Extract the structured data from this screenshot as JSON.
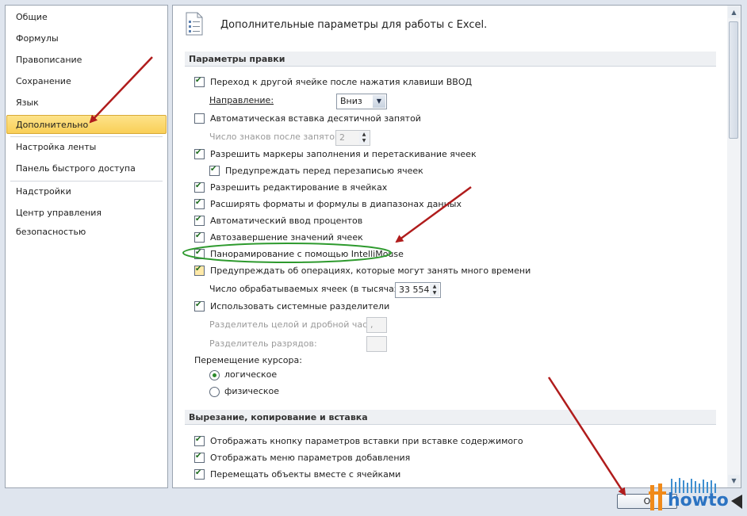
{
  "sidebar": {
    "items": [
      {
        "label": "Общие"
      },
      {
        "label": "Формулы"
      },
      {
        "label": "Правописание"
      },
      {
        "label": "Сохранение"
      },
      {
        "label": "Язык"
      },
      {
        "label": "Дополнительно",
        "selected": true
      },
      {
        "label": "Настройка ленты"
      },
      {
        "label": "Панель быстрого доступа"
      },
      {
        "label": "Надстройки"
      },
      {
        "label": "Центр управления безопасностью"
      }
    ]
  },
  "header": {
    "title": "Дополнительные параметры для работы с Excel."
  },
  "sections": {
    "editing": {
      "title": "Параметры правки",
      "move_after_enter": {
        "label": "Переход к другой ячейке после нажатия клавиши ВВОД",
        "checked": true
      },
      "direction": {
        "label": "Направление:",
        "value": "Вниз"
      },
      "auto_decimal": {
        "label": "Автоматическая вставка десятичной запятой",
        "checked": false
      },
      "decimal_places": {
        "label": "Число знаков после запятой:",
        "value": "2"
      },
      "fill_handle": {
        "label": "Разрешить маркеры заполнения и перетаскивание ячеек",
        "checked": true
      },
      "overwrite_warn": {
        "label": "Предупреждать перед перезаписью ячеек",
        "checked": true
      },
      "edit_in_cell": {
        "label": "Разрешить редактирование в ячейках",
        "checked": true
      },
      "extend_formats": {
        "label": "Расширять форматы и формулы в диапазонах данных",
        "checked": true
      },
      "auto_percent": {
        "label": "Автоматический ввод процентов",
        "checked": true
      },
      "autocomplete": {
        "label": "Автозавершение значений ячеек",
        "checked": true
      },
      "intellimouse": {
        "label": "Панорамирование с помощью IntelliMouse",
        "checked": true
      },
      "warn_long_ops": {
        "label": "Предупреждать об операциях, которые могут занять много времени",
        "checked": true
      },
      "cells_count": {
        "label": "Число обрабатываемых ячеек (в тысячах):",
        "value": "33 554"
      },
      "system_separators": {
        "label": "Использовать системные разделители",
        "checked": true
      },
      "decimal_sep": {
        "label": "Разделитель целой и дробной части:",
        "value": ","
      },
      "thousands_sep": {
        "label": "Разделитель разрядов:",
        "value": ""
      },
      "cursor_move": {
        "label": "Перемещение курсора:",
        "options": [
          "логическое",
          "физическое"
        ],
        "selected": "логическое"
      }
    },
    "clipboard": {
      "title": "Вырезание, копирование и вставка",
      "paste_options": {
        "label": "Отображать кнопку параметров вставки при вставке содержимого",
        "checked": true
      },
      "insert_options": {
        "label": "Отображать меню параметров добавления",
        "checked": true
      },
      "move_objects": {
        "label": "Перемещать объекты вместе с ячейками",
        "checked": true
      }
    }
  },
  "footer": {
    "ok_label": "О"
  },
  "logo": {
    "text": "howto"
  },
  "colors": {
    "arrow": "#b01c1c",
    "highlight_ellipse": "#2e9a2e",
    "selected_nav": "#f9d262"
  },
  "icons": [
    "document-options-icon",
    "checkbox-icon",
    "radio-icon",
    "dropdown-arrow-icon",
    "spinner-icon",
    "scroll-up-icon",
    "scroll-down-icon"
  ]
}
